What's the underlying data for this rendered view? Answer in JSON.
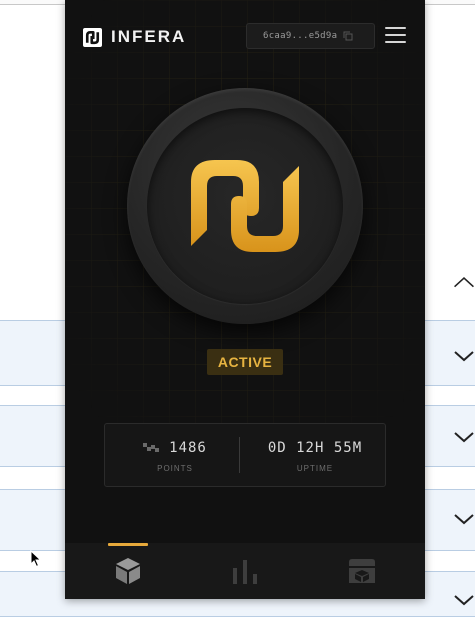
{
  "app": {
    "brand": "INFERA",
    "wallet_address": "6caa9...e5d9a",
    "status": "ACTIVE",
    "stats": {
      "points_value": "1486",
      "points_label": "POINTS",
      "uptime_value": "0D 12H 55M",
      "uptime_label": "UPTIME"
    },
    "nav": [
      {
        "name": "node",
        "icon": "cube-icon",
        "active": true
      },
      {
        "name": "stats",
        "icon": "bar-chart-icon",
        "active": false
      },
      {
        "name": "store",
        "icon": "store-icon",
        "active": false
      }
    ]
  },
  "background_page": {
    "chevrons": [
      "chevron-up-icon",
      "chevron-down-icon",
      "chevron-down-icon",
      "chevron-down-icon",
      "chevron-down-icon"
    ]
  },
  "colors": {
    "accent": "#e7a93b",
    "popup_bg": "#111111",
    "status_text": "#e7b441",
    "row_bg": "#eef4fb"
  }
}
